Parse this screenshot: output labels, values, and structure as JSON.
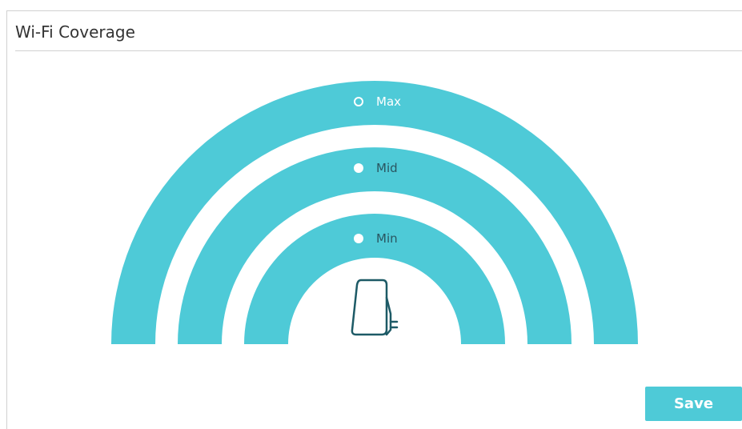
{
  "section": {
    "title": "Wi-Fi Coverage"
  },
  "coverage": {
    "options": [
      {
        "label": "Max",
        "selected": true
      },
      {
        "label": "Mid",
        "selected": false
      },
      {
        "label": "Min",
        "selected": false
      }
    ],
    "arc_color": "#4ecad7",
    "device_color": "#1d5a66"
  },
  "actions": {
    "save_label": "Save",
    "save_color": "#4ecad7"
  }
}
